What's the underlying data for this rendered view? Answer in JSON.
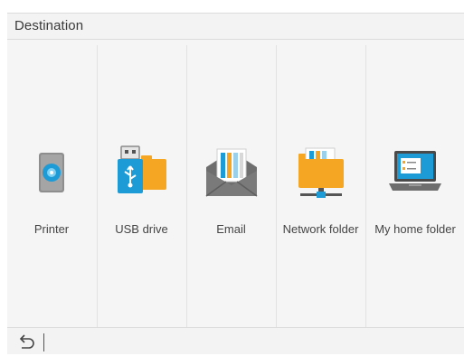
{
  "header": {
    "title": "Destination"
  },
  "destinations": [
    {
      "label": "Printer",
      "icon": "printer-disk-icon"
    },
    {
      "label": "USB drive",
      "icon": "usb-drive-icon"
    },
    {
      "label": "Email",
      "icon": "email-icon"
    },
    {
      "label": "Network folder",
      "icon": "network-folder-icon"
    },
    {
      "label": "My home folder",
      "icon": "home-folder-icon"
    }
  ],
  "footer": {
    "back_icon": "back-arrow-icon"
  },
  "colors": {
    "accent_blue": "#1d9bd6",
    "folder_orange": "#f5a623",
    "panel_bg": "#f5f5f5",
    "header_bg": "#f3f3f3"
  }
}
